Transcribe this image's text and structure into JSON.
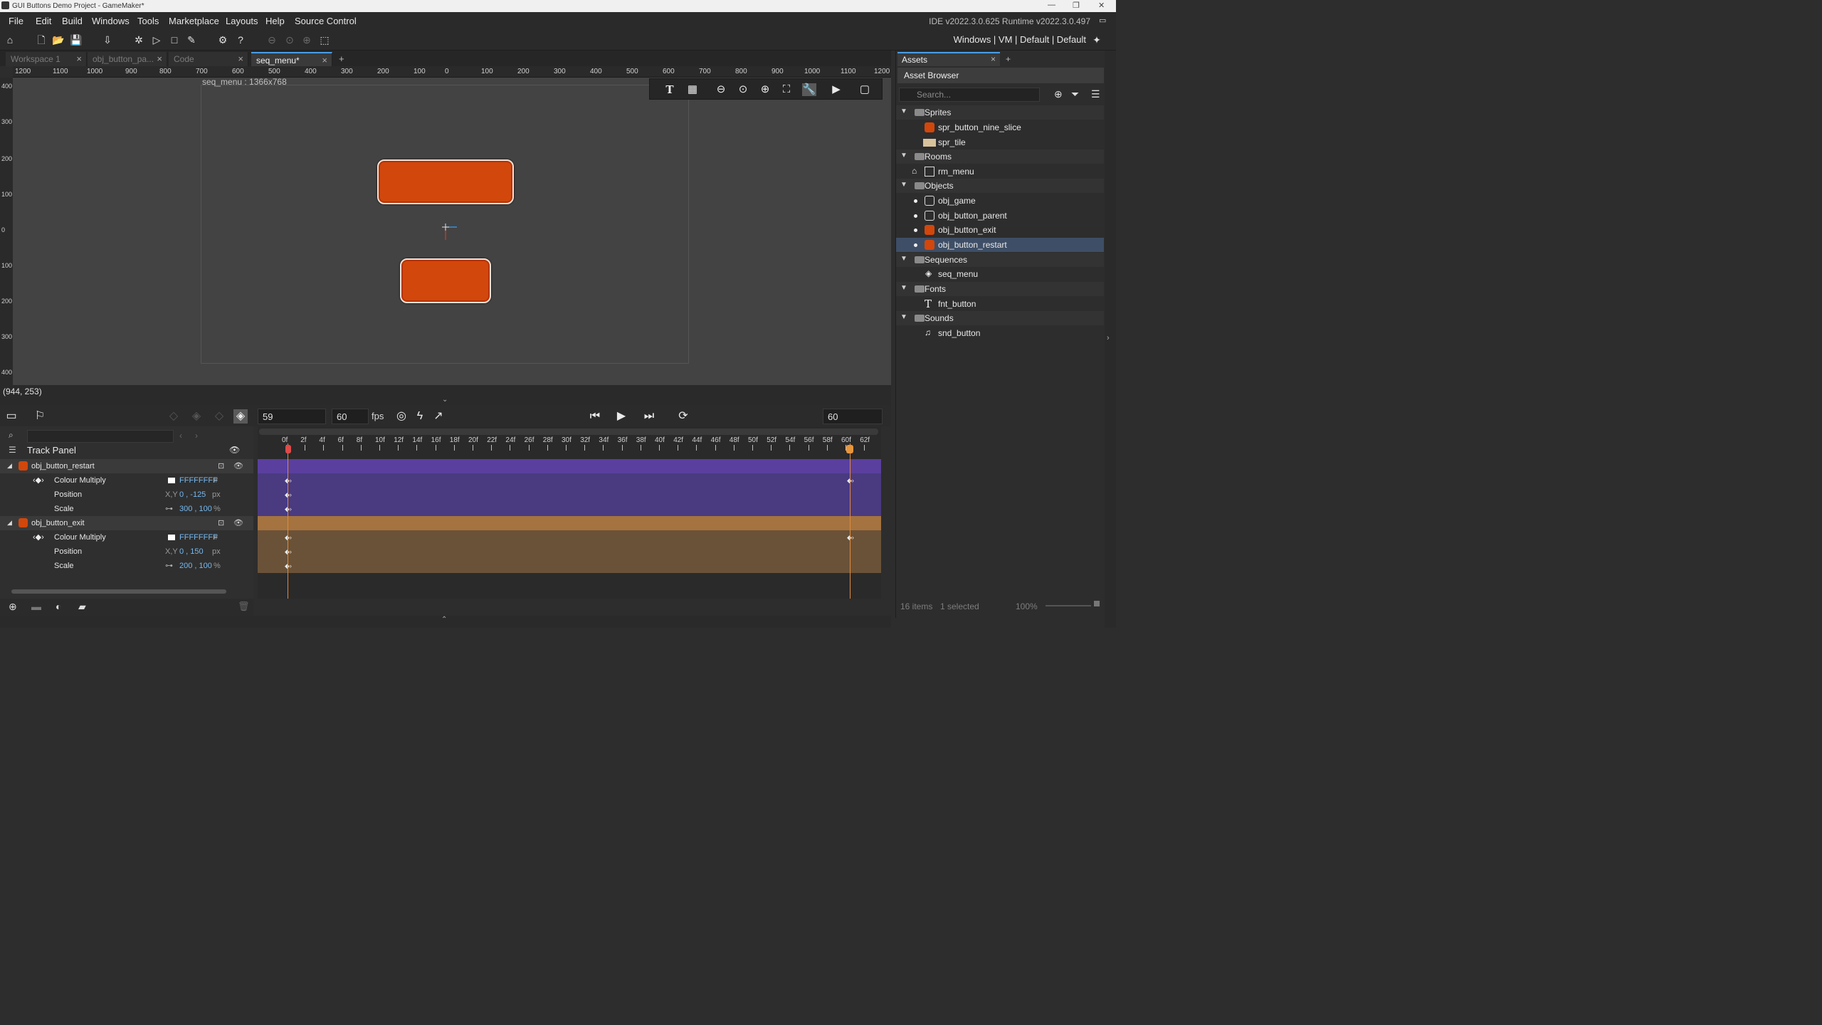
{
  "window": {
    "title": "GUI Buttons Demo Project - GameMaker*",
    "ide_info": "IDE v2022.3.0.625  Runtime v2022.3.0.497",
    "targets": "Windows | VM | Default | Default"
  },
  "menu": [
    "File",
    "Edit",
    "Build",
    "Windows",
    "Tools",
    "Marketplace",
    "Layouts",
    "Help",
    "Source Control"
  ],
  "tabs": [
    {
      "label": "Workspace 1"
    },
    {
      "label": "obj_button_pa..."
    },
    {
      "label": "Code"
    },
    {
      "label": "seq_menu*"
    }
  ],
  "ruler_h": [
    "1200",
    "1100",
    "1000",
    "900",
    "800",
    "700",
    "600",
    "500",
    "400",
    "300",
    "200",
    "100",
    "0",
    "100",
    "200",
    "300",
    "400",
    "500",
    "600",
    "700",
    "800",
    "900",
    "1000",
    "1100",
    "1200"
  ],
  "ruler_v": [
    "400",
    "300",
    "200",
    "100",
    "0",
    "100",
    "200",
    "300",
    "400"
  ],
  "canvas": {
    "caption": "seq_menu : 1366x768"
  },
  "status": {
    "coords": "(944, 253)"
  },
  "sequence": {
    "frame": "59",
    "fps_value": "60",
    "fps_label": "fps",
    "length": "60",
    "track_panel_title": "Track Panel",
    "timeline_labels": [
      "0f",
      "2f",
      "4f",
      "6f",
      "8f",
      "10f",
      "12f",
      "14f",
      "16f",
      "18f",
      "20f",
      "22f",
      "24f",
      "26f",
      "28f",
      "30f",
      "32f",
      "34f",
      "36f",
      "38f",
      "40f",
      "42f",
      "44f",
      "46f",
      "48f",
      "50f",
      "52f",
      "54f",
      "56f",
      "58f",
      "60f",
      "62f"
    ],
    "tracks": [
      {
        "name": "obj_button_restart",
        "params": [
          {
            "label": "Colour Multiply",
            "value": "FFFFFFFF",
            "unit": "#"
          },
          {
            "label": "Position",
            "prefix": "X,Y",
            "value": "0 , -125",
            "unit": "px"
          },
          {
            "label": "Scale",
            "value": "300 , 100",
            "unit": "%"
          }
        ]
      },
      {
        "name": "obj_button_exit",
        "params": [
          {
            "label": "Colour Multiply",
            "value": "FFFFFFFF",
            "unit": "#"
          },
          {
            "label": "Position",
            "prefix": "X,Y",
            "value": "0 , 150",
            "unit": "px"
          },
          {
            "label": "Scale",
            "value": "200 , 100",
            "unit": "%"
          }
        ]
      }
    ]
  },
  "assets": {
    "tab_label": "Assets",
    "browser_title": "Asset Browser",
    "search_placeholder": "Search...",
    "groups": [
      {
        "name": "Sprites",
        "items": [
          "spr_button_nine_slice",
          "spr_tile"
        ]
      },
      {
        "name": "Rooms",
        "items": [
          "rm_menu"
        ]
      },
      {
        "name": "Objects",
        "items": [
          "obj_game",
          "obj_button_parent",
          "obj_button_exit",
          "obj_button_restart"
        ]
      },
      {
        "name": "Sequences",
        "items": [
          "seq_menu"
        ]
      },
      {
        "name": "Fonts",
        "items": [
          "fnt_button"
        ]
      },
      {
        "name": "Sounds",
        "items": [
          "snd_button"
        ]
      }
    ],
    "footer_count": "16 items",
    "footer_selected": "1 selected",
    "footer_zoom": "100%"
  },
  "colors": {
    "accent": "#4a9ee8",
    "button_orange": "#d2470b",
    "track_purple": "#5a3f9e",
    "track_orange": "#a5733f"
  }
}
